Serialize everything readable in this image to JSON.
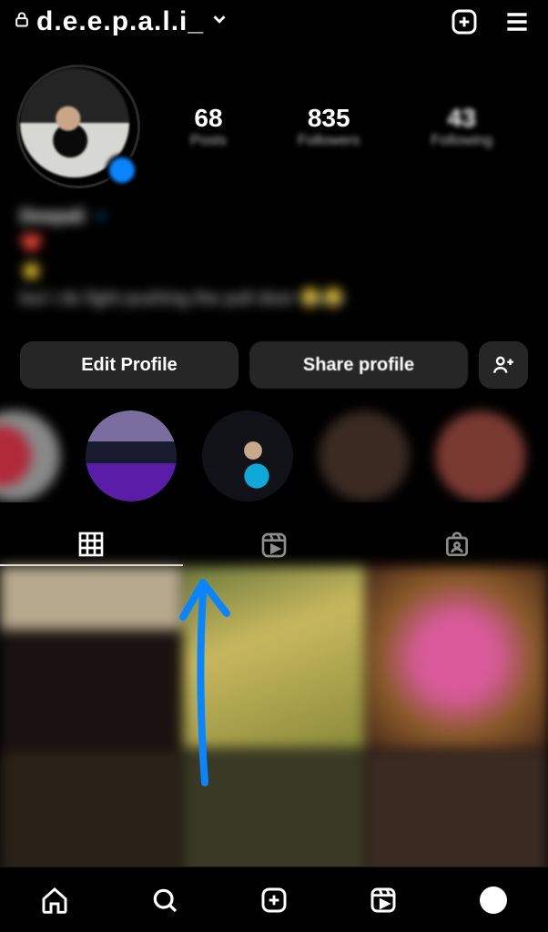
{
  "topbar": {
    "username": "d.e.e.p.a.l.i_"
  },
  "stats": {
    "posts": {
      "count": "68",
      "label": "Posts"
    },
    "followers": {
      "count": "835",
      "label": "Followers"
    },
    "following": {
      "count": "43",
      "label": "Following"
    }
  },
  "bio": {
    "name_line": "Deepali",
    "l2": " ",
    "l3": " ",
    "l4": "but I do fight pushing the pull door"
  },
  "buttons": {
    "edit": "Edit Profile",
    "share": "Share profile"
  },
  "highlights": [
    {
      "label": " "
    },
    {
      "label": "♡"
    },
    {
      "label": " "
    },
    {
      "label": " "
    },
    {
      "label": " "
    }
  ]
}
